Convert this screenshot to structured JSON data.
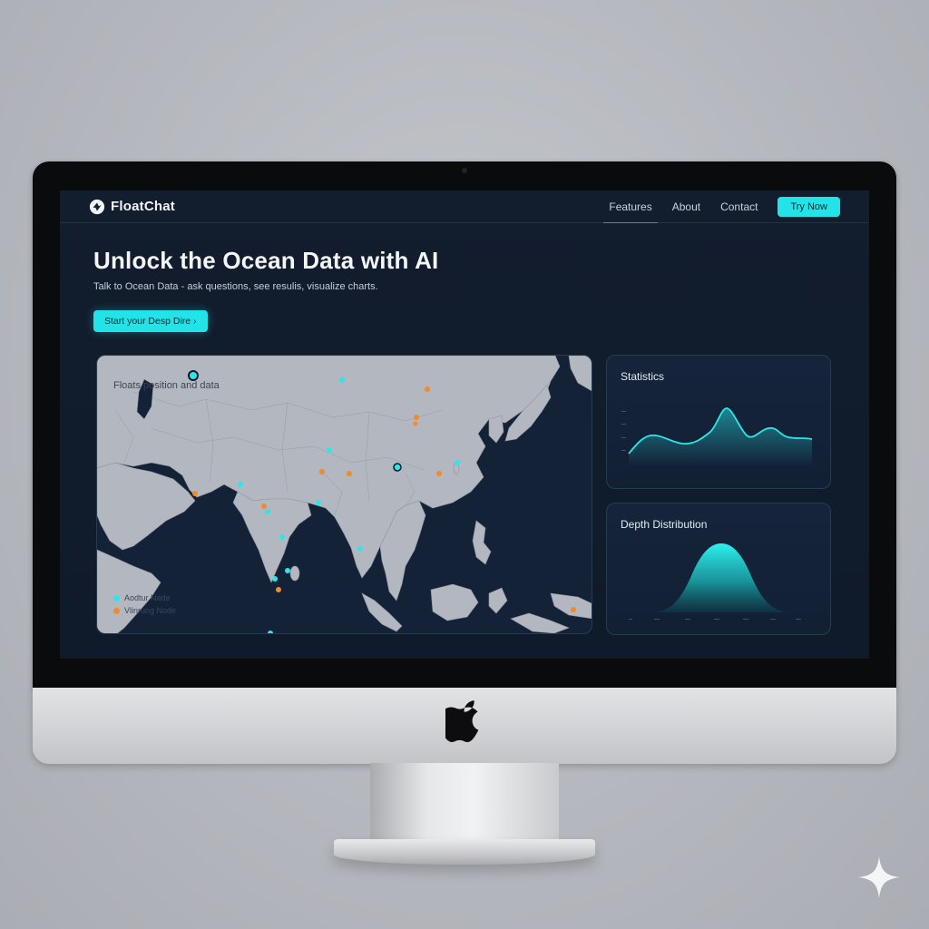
{
  "nav": {
    "brand": "FloatChat",
    "links": [
      "Features",
      "About",
      "Contact"
    ],
    "cta": "Try Now"
  },
  "hero": {
    "title": "Unlock the Ocean Data with AI",
    "subtitle": "Talk to Ocean Data - ask questions, see resulis, visualize charts.",
    "cta": "Start your Desp Dire",
    "cta_icon": "chevron-right-icon"
  },
  "map": {
    "title": "Floats position and data",
    "legend": [
      {
        "label": "Aodtur Nade",
        "color": "#2ee6ea"
      },
      {
        "label": "Vlinrung Node",
        "color": "#f08a2c"
      }
    ]
  },
  "cards": {
    "statistics": "Statistics",
    "depth": "Depth Distribution"
  },
  "colors": {
    "accent": "#21e3e8",
    "orange_node": "#f08a2c",
    "background": "#0f1a2a"
  }
}
